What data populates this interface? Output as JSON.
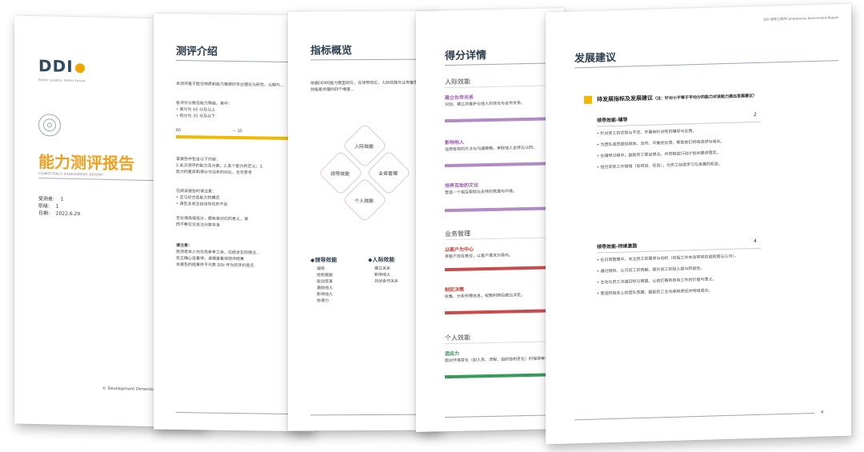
{
  "cover": {
    "logo_text": "DDI",
    "logo_tagline": "Better Leaders. Better Future.",
    "title": "能力测评报告",
    "subtitle_en": "COMPETENCY ASSESSMENT REPORT",
    "fields": [
      {
        "label": "受测者:",
        "value": "1"
      },
      {
        "label": "职级:",
        "value": "1"
      },
      {
        "label": "日期:",
        "value": "2022.6.29"
      }
    ],
    "footer": "© Development Dimensions"
  },
  "intro": {
    "title": "测评介绍",
    "para1": "本测评基于胜任特质和能力框架的专业理论与研究，以期与...",
    "para2_head": "各评价分数及能力等级，其中：",
    "bullets": [
      "• 高分为 65 分及以上",
      "• 低分为 35 分及以下"
    ],
    "scale_left": "65",
    "scale_mid": "— 35",
    "para3": "该报告中包含以下内容：",
    "para3_lines": [
      "1.此次测评的能力及分数；2.各个能力的定义；3.",
      "能力的差异和得分与往年的对比，也可参考"
    ],
    "para4": "在阅读报告时请注意：",
    "para4_lines": [
      "• 这与综合各能力的模式",
      "• 请您多关注自身存在的不足"
    ],
    "para5": "无论得高或低分，都有其对应的意义，请",
    "para5b": "而不要仅仅关注分数本身",
    "note_head": "请注意：",
    "note_lines": [
      "受测者本人在仅供参考之余，应结合实际情况...",
      "及正确心态看待，请慎重看待测评结果",
      "本报告的结果并不代表 DDI 作为的评价观点"
    ]
  },
  "overview": {
    "title": "指标概览",
    "para": "依据DDI的能力模型研究，在领导岗位，人际效能与业务管理、个人效能是关键的四个维度...",
    "diamonds": [
      "人际效能",
      "领导效能",
      "业务管理",
      "个人效能"
    ],
    "legend_a": "◆领导效能",
    "legend_a_items": [
      "辅导",
      "授权赋能",
      "驱动变革",
      "激励他人",
      "影响他人",
      "协调力"
    ],
    "legend_b": "◆人际效能",
    "legend_b_items": [
      "建立关系",
      "影响他人",
      "共创合作关系"
    ]
  },
  "scores": {
    "title": "得分详情",
    "group1": "人际效能",
    "items1": [
      {
        "name": "建立伙伴关系",
        "desc": "识别、建立并维护与他人的信任与合作关系。",
        "color": "#b489c6"
      },
      {
        "name": "影响他人",
        "desc": "运用有效的方法与沟通策略，争取他人支持与认同。",
        "color": "#b489c6"
      },
      {
        "name": "培养互助的文化",
        "desc": "营造一个相互帮助与支持的氛围与环境。",
        "color": "#b489c6"
      }
    ],
    "group2": "业务管理",
    "items2": [
      {
        "name": "以客户为中心",
        "desc": "将客户放在首位，以客户需求为导向。",
        "color": "#c94c4c"
      },
      {
        "name": "制定决策",
        "desc": "收集、分析所需信息，权衡利弊后做出决定。",
        "color": "#c94c4c"
      }
    ],
    "group3": "个人效能",
    "items3": [
      {
        "name": "适应力",
        "desc": "面对环境变化（如人员、流程、组织结构变化）时保持有效性。",
        "color": "#3a9a5b"
      }
    ]
  },
  "advice": {
    "header_right": "DDI 领导力测评Competency Assessment Report",
    "title": "发展建议",
    "box_label": "待发展指标及发展建议",
    "box_note": "（注：针对小于等于平均分的能力对该能力提出发展建议）",
    "sec1_title": "领导效能-辅导",
    "sec1_num": "2",
    "sec1_lines": [
      "• 针对员工的优势与不足，开展有针对性的辅导与反馈。",
      "• 为团队成员提供具体、及时、平衡的反馈，帮助他们持续改进与成长。",
      "• 在辅导过程中，鼓励员工提出想法，共同制定行动计划并跟进落实。",
      "• 结合实际工作情境（如项目、任务），为员工创造学习与发展的机会。"
    ],
    "sec2_title": "领导效能-持续激励",
    "sec2_num": "4",
    "sec2_lines": [
      "• 在日常管理中，关注员工的需求与动机（包括工作本身带来的成就感与认可）。",
      "• 通过授权、认可员工的贡献，提升员工的投入度与积极性。",
      "• 主动与员工沟通目标与期望，让他们看到自身工作的价值与意义。",
      "• 营造积极向上的团队氛围，鼓励员工主动承担责任并持续成长。"
    ],
    "page_num": "4"
  }
}
